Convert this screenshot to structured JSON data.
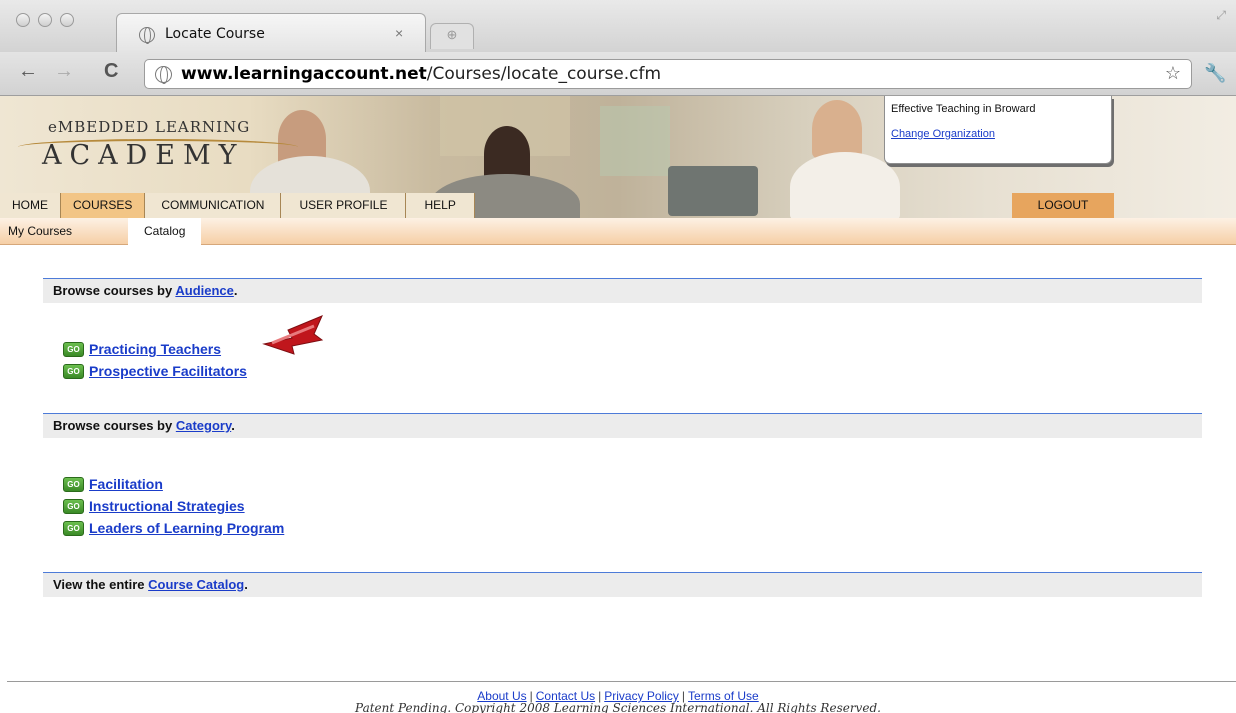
{
  "browser": {
    "tab_title": "Locate Course",
    "tab_close": "×",
    "url_host": "www.learningaccount.net",
    "url_path": "/Courses/locate_course.cfm"
  },
  "logo": {
    "line1": "eMBEDDED LEARNING",
    "line2": "ACADEMY"
  },
  "org": {
    "name": "Effective Teaching in Broward",
    "change_link": "Change Organization"
  },
  "main_nav": [
    "HOME",
    "COURSES",
    "COMMUNICATION",
    "USER PROFILE",
    "HELP"
  ],
  "main_nav_active": "COURSES",
  "logout_label": "LOGOUT",
  "sub_nav": [
    "My Courses",
    "Catalog"
  ],
  "sub_nav_active": "Catalog",
  "sections": {
    "audience": {
      "prefix": "Browse courses by ",
      "link": "Audience",
      "suffix": ".",
      "items": [
        "Practicing Teachers",
        "Prospective Facilitators"
      ]
    },
    "category": {
      "prefix": "Browse courses by ",
      "link": "Category",
      "suffix": ".",
      "items": [
        "Facilitation",
        "Instructional Strategies",
        "Leaders of Learning Program"
      ]
    },
    "catalog": {
      "prefix": "View the entire ",
      "link": "Course Catalog",
      "suffix": "."
    }
  },
  "go_icon_text": "GO",
  "footer": {
    "links": [
      "About Us",
      "Contact Us",
      "Privacy Policy",
      "Terms of Use"
    ],
    "separator": "|",
    "copyright": "Patent Pending. Copyright 2008 Learning Sciences International. All Rights Reserved."
  },
  "icons": {
    "back": "arrow-left-icon",
    "forward": "arrow-right-icon",
    "reload": "reload-icon",
    "bookmark": "star-icon",
    "menu": "wrench-icon",
    "pointer": "red-arrow-icon"
  },
  "colors": {
    "link": "#1a3cc9",
    "nav_active": "#f2c586",
    "logout": "#e7a55e",
    "go_icon": "#3a8a26",
    "section_bar": "#ececec",
    "arrow": "#c0161c"
  }
}
